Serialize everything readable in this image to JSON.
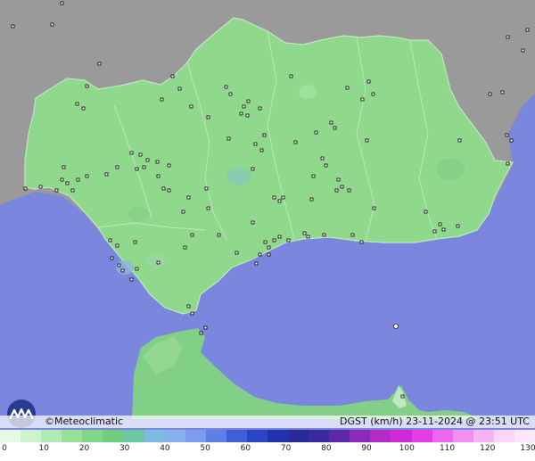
{
  "branding": {
    "copyright": "©",
    "name": "Meteoclimatic"
  },
  "map": {
    "caption": "DGST (km/h)  23-11-2024 @ 23:51 UTC",
    "sea_color": "#7b86de",
    "land_color": "#8fd88c",
    "outside_land_color": "#9a9a9a"
  },
  "legend": {
    "tick_labels": [
      "0",
      "10",
      "20",
      "30",
      "40",
      "50",
      "60",
      "70",
      "80",
      "90",
      "100",
      "110",
      "120",
      "130"
    ],
    "colors": [
      "#e6fae6",
      "#cdf3cd",
      "#b0eab4",
      "#96e09a",
      "#82d88a",
      "#6fcf7e",
      "#6dc6a4",
      "#7dbce0",
      "#8aaef2",
      "#7c9cf0",
      "#5f7fe6",
      "#3f5fd8",
      "#2a45c6",
      "#1f33ad",
      "#2a2a99",
      "#3b2a9e",
      "#5b2aa8",
      "#8a2ab8",
      "#b32ac6",
      "#d02ad8",
      "#e53de6",
      "#ef66ee",
      "#f38ff3",
      "#f7b3f6",
      "#fbd6fa",
      "#fde7fc"
    ]
  }
}
